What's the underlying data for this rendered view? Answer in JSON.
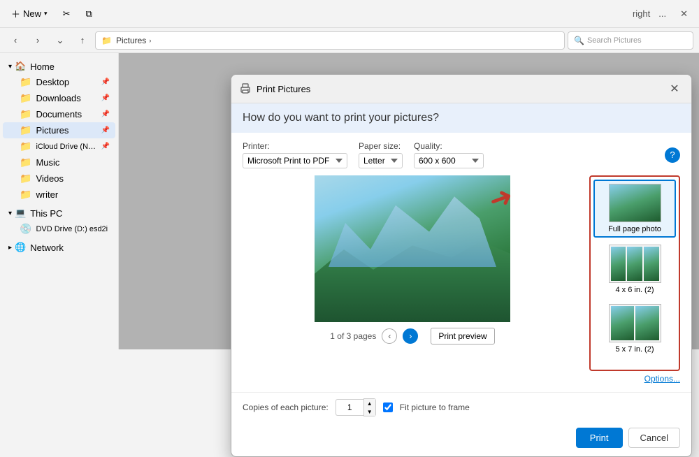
{
  "topbar": {
    "new_label": "New",
    "more_options": "...",
    "right_label": "right"
  },
  "navbar": {
    "address": "Pictures",
    "search_placeholder": "Search Pictures"
  },
  "sidebar": {
    "home_label": "Home",
    "items": [
      {
        "id": "desktop",
        "label": "Desktop",
        "icon": "📁",
        "pinned": true
      },
      {
        "id": "downloads",
        "label": "Downloads",
        "icon": "📁",
        "pinned": true
      },
      {
        "id": "documents",
        "label": "Documents",
        "icon": "📁",
        "pinned": true
      },
      {
        "id": "pictures",
        "label": "Pictures",
        "icon": "📁",
        "pinned": true,
        "active": true
      },
      {
        "id": "icloud",
        "label": "iCloud Drive (N…",
        "icon": "📁",
        "pinned": true
      },
      {
        "id": "music",
        "label": "Music",
        "icon": "📁"
      },
      {
        "id": "videos",
        "label": "Videos",
        "icon": "📁"
      },
      {
        "id": "writer",
        "label": "writer",
        "icon": "📁"
      }
    ],
    "this_pc": "This PC",
    "dvd": "DVD Drive (D:) esd2i",
    "network": "Network"
  },
  "dialog": {
    "title": "Print Pictures",
    "header_question": "How do you want to print your pictures?",
    "printer_label": "Printer:",
    "printer_value": "Microsoft Print to PDF",
    "paper_label": "Paper size:",
    "paper_value": "Letter",
    "quality_label": "Quality:",
    "quality_value": "600 x 600",
    "page_indicator": "1 of 3 pages",
    "print_preview_label": "Print preview",
    "layout_options": [
      {
        "id": "full-page",
        "label": "Full page photo",
        "selected": true
      },
      {
        "id": "4x6",
        "label": "4 x 6 in. (2)",
        "selected": false
      },
      {
        "id": "5x7",
        "label": "5 x 7 in. (2)",
        "selected": false
      }
    ],
    "copies_label": "Copies of each picture:",
    "copies_value": "1",
    "fit_label": "Fit picture to frame",
    "options_label": "Options...",
    "print_button": "Print",
    "cancel_button": "Cancel"
  }
}
